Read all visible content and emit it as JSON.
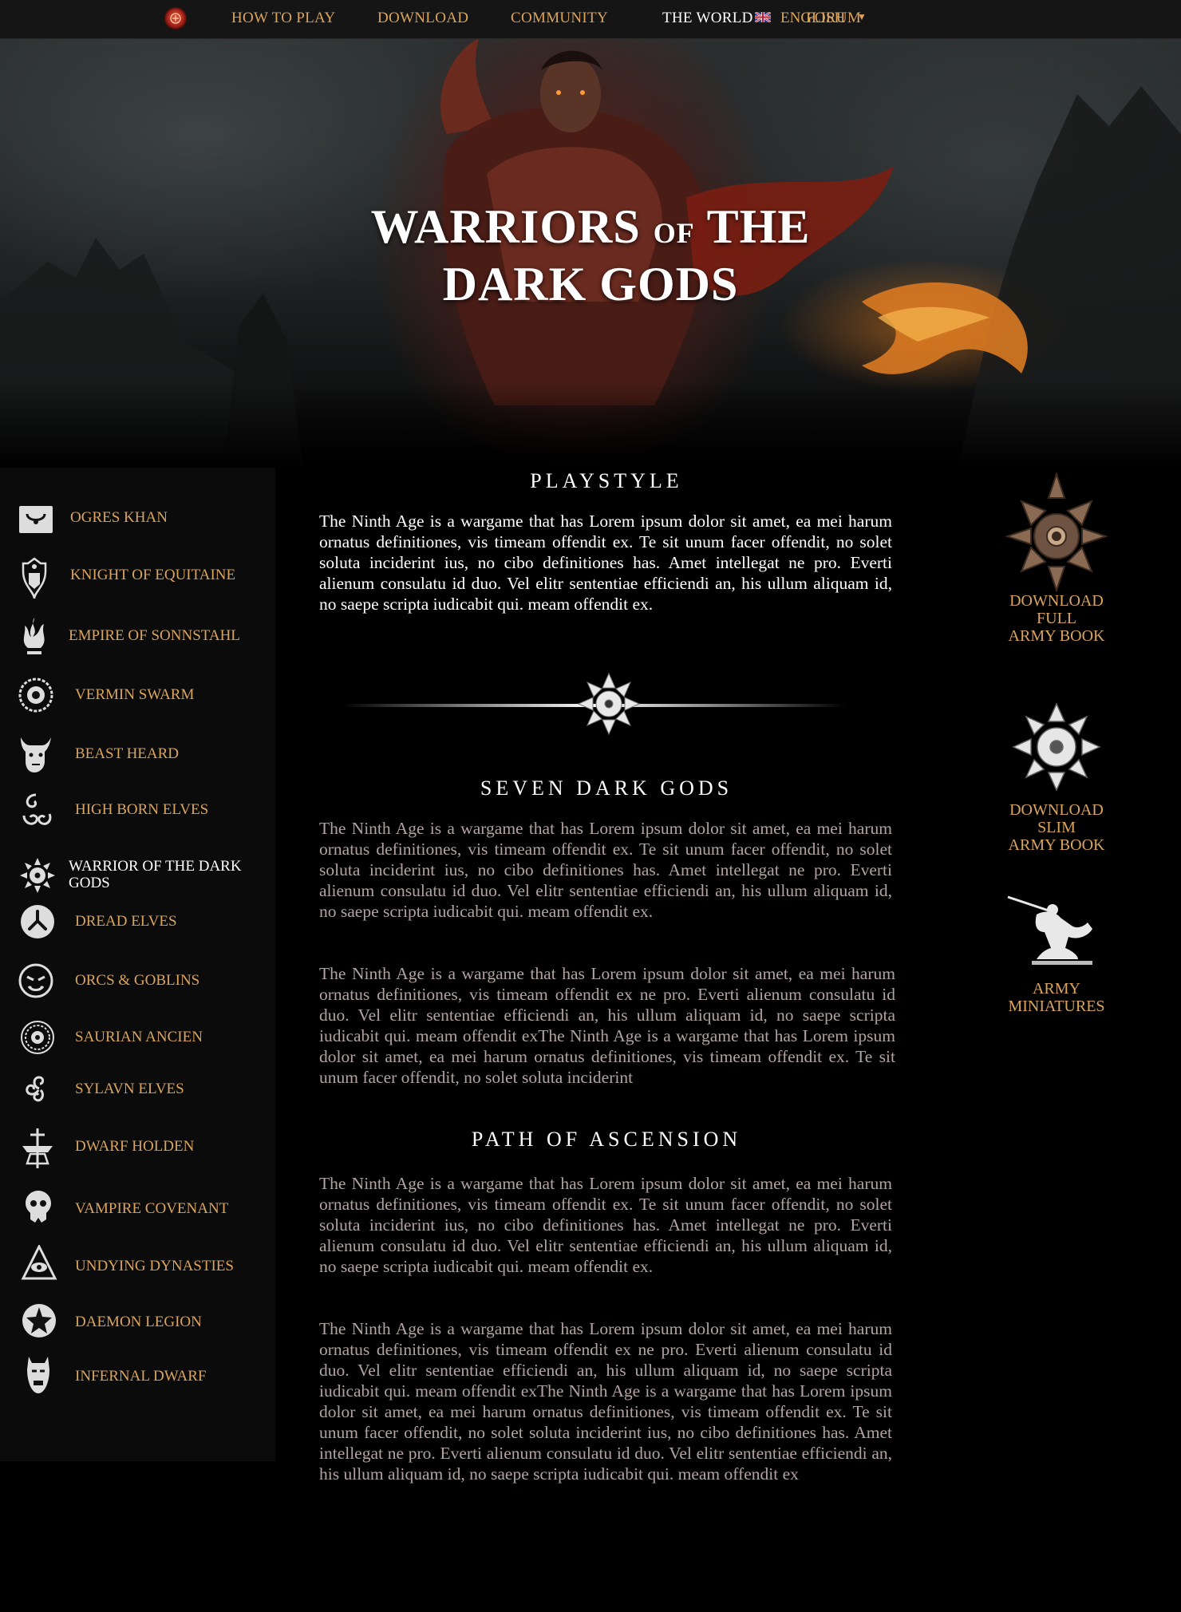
{
  "nav": {
    "links": [
      "HOW TO PLAY",
      "DOWNLOAD",
      "COMMUNITY",
      "THE WORLD",
      "FORUM"
    ],
    "language": "ENGLISH"
  },
  "hero": {
    "title_line1_a": "WARRIORS",
    "title_of": "OF",
    "title_line1_b": "THE",
    "title_line2": "DARK GODS"
  },
  "sidebar": {
    "items": [
      {
        "label": "OGRES KHAN",
        "icon": "ogre-icon"
      },
      {
        "label": "KNIGHT OF EQUITAINE",
        "icon": "knight-crest-icon"
      },
      {
        "label": "EMPIRE OF SONNSTAHL",
        "icon": "empire-flame-icon"
      },
      {
        "label": "VERMIN SWARM",
        "icon": "vermin-wreath-icon"
      },
      {
        "label": "BEAST HEARD",
        "icon": "beast-head-icon"
      },
      {
        "label": "HIGH BORN ELVES",
        "icon": "elf-swirl-icon"
      },
      {
        "label": "WARRIOR OF THE DARK GODS",
        "icon": "chaos-star-icon",
        "active": true
      },
      {
        "label": "DREAD ELVES",
        "icon": "dread-elf-icon"
      },
      {
        "label": "ORCS & GOBLINS",
        "icon": "orc-face-icon"
      },
      {
        "label": "SAURIAN ANCIEN",
        "icon": "saurian-disc-icon"
      },
      {
        "label": "SYLAVN ELVES",
        "icon": "triskele-icon"
      },
      {
        "label": "DWARF HOLDEN",
        "icon": "dwarf-anvil-icon"
      },
      {
        "label": "VAMPIRE COVENANT",
        "icon": "vampire-skull-icon"
      },
      {
        "label": "UNDYING DYNASTIES",
        "icon": "undying-eye-icon"
      },
      {
        "label": "DAEMON LEGION",
        "icon": "daemon-star-icon"
      },
      {
        "label": "INFERNAL DWARF",
        "icon": "infernal-mask-icon"
      }
    ]
  },
  "main": {
    "playstyle": {
      "title": "PLAYSTYLE",
      "text": "The Ninth Age is a wargame that has Lorem ipsum dolor sit amet, ea mei harum ornatus definitiones, vis timeam offendit ex.  Te sit unum facer offendit, no solet soluta inciderint ius, no cibo definitiones has. Amet intellegat ne pro. Everti alienum consulatu id duo. Vel elitr sententiae efficiendi an, his ullum aliquam id, no saepe scripta iudicabit qui. meam offendit ex."
    },
    "gods": {
      "title": "SEVEN DARK GODS",
      "text1": "The Ninth Age is a wargame that has Lorem ipsum dolor sit amet, ea mei harum ornatus definitiones, vis timeam offendit ex.  Te sit unum facer offendit, no solet soluta inciderint ius, no cibo definitiones has. Amet intellegat ne pro. Everti alienum consulatu id duo. Vel elitr sententiae efficiendi an, his ullum aliquam id, no saepe scripta iudicabit qui. meam offendit ex.",
      "text2": "The Ninth Age is a wargame that has Lorem ipsum dolor sit amet, ea mei harum ornatus definitiones, vis timeam offendit ex ne pro. Everti alienum consulatu id duo. Vel elitr sententiae efficiendi an, his ullum aliquam id, no saepe scripta iudicabit qui. meam offendit exThe Ninth Age is a wargame that has Lorem ipsum dolor sit amet, ea mei harum ornatus definitiones, vis timeam offendit ex.  Te sit unum facer offendit, no solet soluta inciderint"
    },
    "ascension": {
      "title": "PATH OF ASCENSION",
      "text1": "The Ninth Age is a wargame that has Lorem ipsum dolor sit amet, ea mei harum ornatus definitiones, vis timeam offendit ex.  Te sit unum facer offendit, no solet soluta inciderint ius, no cibo definitiones has. Amet intellegat ne pro. Everti alienum consulatu id duo. Vel elitr sententiae efficiendi an, his ullum aliquam id, no saepe scripta iudicabit qui. meam offendit ex.",
      "text2": "The Ninth Age is a wargame that has Lorem ipsum dolor sit amet, ea mei harum ornatus definitiones, vis timeam offendit ex ne pro. Everti alienum consulatu id duo. Vel elitr sententiae efficiendi an, his ullum aliquam id, no saepe scripta iudicabit qui. meam offendit exThe Ninth Age is a wargame that has Lorem ipsum dolor sit amet, ea mei harum ornatus definitiones, vis timeam offendit ex.  Te sit unum facer offendit, no solet soluta inciderint ius, no cibo definitiones has. Amet intellegat ne pro. Everti alienum consulatu id duo. Vel elitr sententiae efficiendi an, his ullum aliquam id, no saepe scripta iudicabit qui. meam offendit ex"
    }
  },
  "downloads": {
    "full": {
      "l1": "DOWNLOAD",
      "l2": "FULL",
      "l3": "ARMY BOOK",
      "icon": "bronze-chaos-star-icon"
    },
    "slim": {
      "l1": "DOWNLOAD",
      "l2": "SLIM",
      "l3": "ARMY BOOK",
      "icon": "silver-chaos-star-icon"
    },
    "minis": {
      "l1": "ARMY",
      "l2": "MINIATURES",
      "icon": "miniature-figure-icon"
    }
  },
  "colors": {
    "accent": "#d9a45e",
    "background": "#000000",
    "muted_text": "#b2a3a3"
  }
}
